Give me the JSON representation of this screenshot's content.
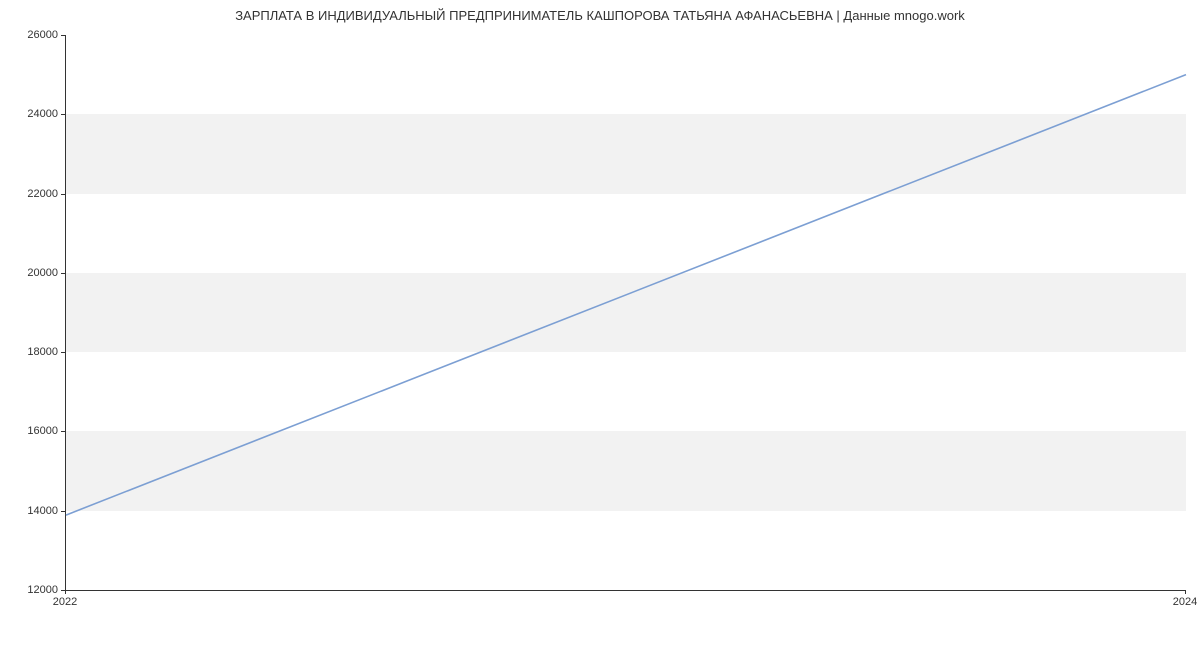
{
  "chart_data": {
    "type": "line",
    "title": "ЗАРПЛАТА В ИНДИВИДУАЛЬНЫЙ ПРЕДПРИНИМАТЕЛЬ КАШПОРОВА ТАТЬЯНА АФАНАСЬЕВНА | Данные mnogo.work",
    "xlabel": "",
    "ylabel": "",
    "x": [
      2022,
      2024
    ],
    "values": [
      13890,
      25000
    ],
    "xlim": [
      2022,
      2024
    ],
    "ylim": [
      12000,
      26000
    ],
    "x_ticks": [
      2022,
      2024
    ],
    "y_ticks": [
      12000,
      14000,
      16000,
      18000,
      20000,
      22000,
      24000,
      26000
    ],
    "line_color": "#7c9fd3",
    "band_color": "#f2f2f2"
  }
}
